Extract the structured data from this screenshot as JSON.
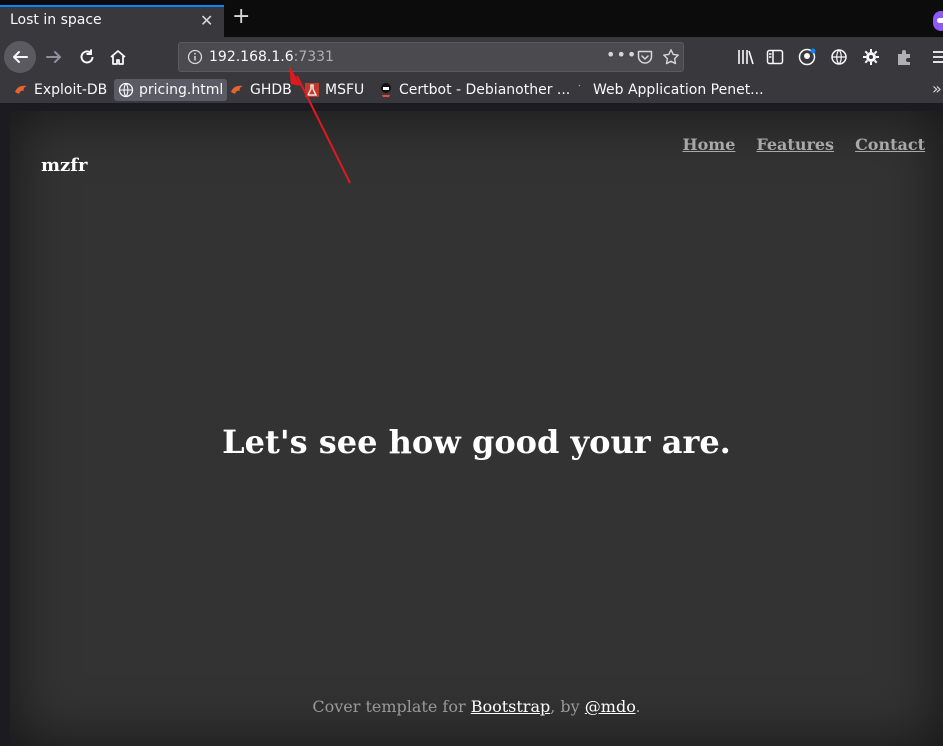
{
  "browser": {
    "tab": {
      "title": "Lost in space",
      "close": "✕"
    },
    "new_tab": "+",
    "url": {
      "host": "192.168.1.6",
      "port": ":7331",
      "menu": "•••"
    },
    "bookmarks": [
      {
        "label": "Exploit-DB",
        "icon": "exploit-db-icon"
      },
      {
        "label": "pricing.html",
        "icon": "globe-icon"
      },
      {
        "label": "GHDB",
        "icon": "exploit-db-icon"
      },
      {
        "label": "MSFU",
        "icon": "flask-icon"
      },
      {
        "label": "Certbot - Debianother ...",
        "icon": "certbot-icon"
      },
      {
        "label": "Web Application Penet...",
        "icon": "blank-icon"
      }
    ],
    "bookmarks_more": "»"
  },
  "page": {
    "brand": "mzfr",
    "nav": [
      "Home",
      "Features",
      "Contact"
    ],
    "headline": "Let's see how good your are.",
    "footer": {
      "prefix": "Cover template for ",
      "link1": "Bootstrap",
      "middle": ", by ",
      "link2": "@mdo",
      "suffix": "."
    }
  },
  "colors": {
    "accent": "#0a84ff",
    "toolbar": "#38383d",
    "page_background": "#333333",
    "arrow": "#e0191c"
  }
}
